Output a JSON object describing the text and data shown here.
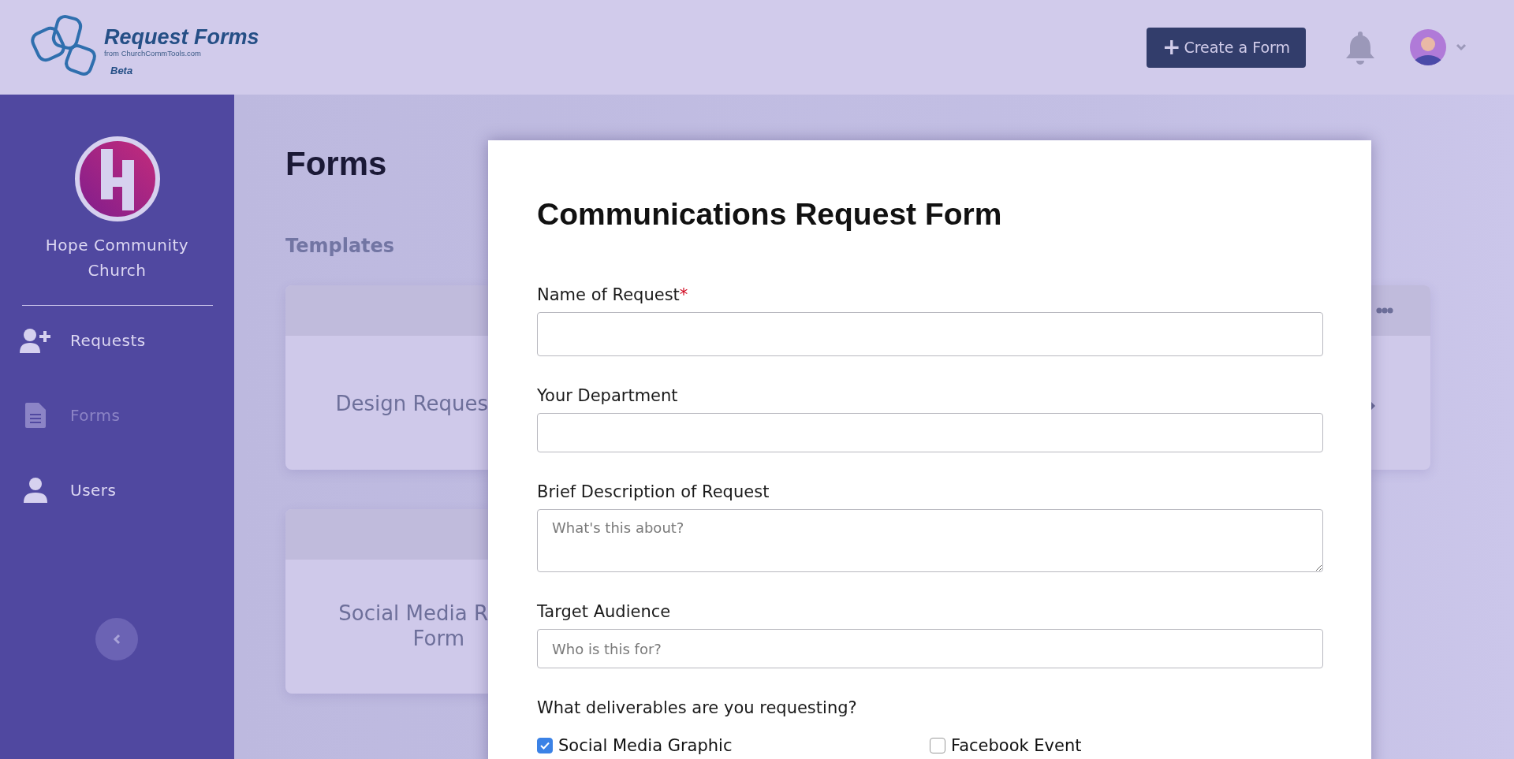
{
  "header": {
    "logo": {
      "title": "Request Forms",
      "subtitle": "from ChurchCommTools.com",
      "badge": "Beta"
    },
    "create_button": {
      "icon": "+",
      "label": "Create a Form"
    }
  },
  "sidebar": {
    "org_name": "Hope Community Church",
    "items": [
      {
        "kind": "requests",
        "label": "Requests",
        "selected": false
      },
      {
        "kind": "forms",
        "label": "Forms",
        "selected": true
      },
      {
        "kind": "users",
        "label": "Users",
        "selected": false
      }
    ]
  },
  "page": {
    "title": "Forms",
    "section": "Templates",
    "cards": [
      {
        "lines": [
          "Design Reques"
        ]
      },
      {
        "lines": [
          "Social Media R",
          "Form"
        ]
      }
    ]
  },
  "modal": {
    "title": "Communications Request Form",
    "fields": [
      {
        "kind": "input",
        "label": "Name of Request",
        "required_mark": "*"
      },
      {
        "kind": "input",
        "label": "Your Department"
      },
      {
        "kind": "textarea",
        "label": "Brief Description of Request",
        "placeholder": "What's this about?"
      },
      {
        "kind": "input",
        "label": "Target Audience",
        "placeholder": "Who is this for?"
      },
      {
        "kind": "checkboxes",
        "label": "What deliverables are you requesting?",
        "options": [
          {
            "label": "Social Media Graphic",
            "checked": true
          },
          {
            "label": "Facebook Event",
            "checked": false
          }
        ]
      }
    ]
  }
}
